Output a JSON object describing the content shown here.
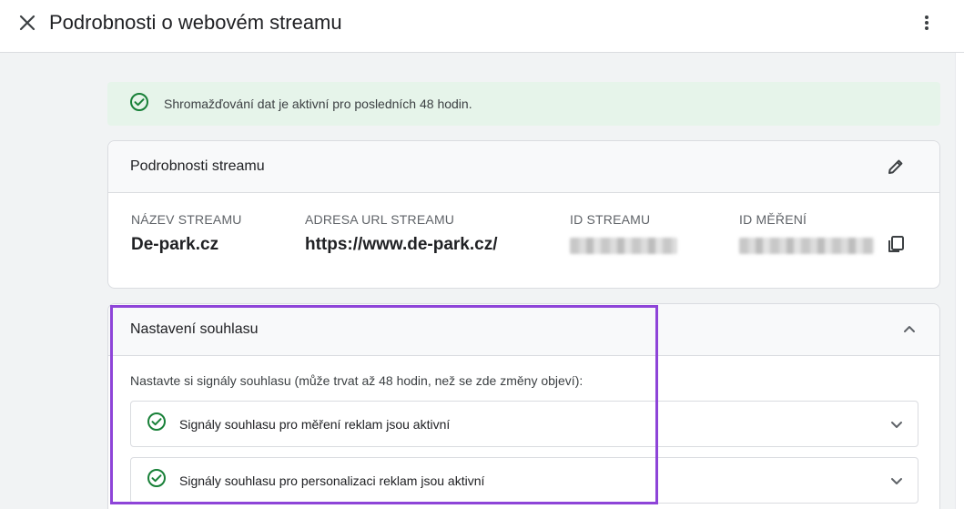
{
  "header": {
    "title": "Podrobnosti o webovém streamu",
    "close_icon": "close-icon",
    "more_icon": "more-vert-icon"
  },
  "banner": {
    "text": "Shromažďování dat je aktivní pro posledních 48 hodin.",
    "icon": "check-circle-icon",
    "color": "#188038"
  },
  "stream_details": {
    "title": "Podrobnosti streamu",
    "edit_icon": "pencil-icon",
    "fields": [
      {
        "label": "NÁZEV STREAMU",
        "value": "De-park.cz"
      },
      {
        "label": "ADRESA URL STREAMU",
        "value": "https://www.de-park.cz/"
      },
      {
        "label": "ID STREAMU",
        "value": ""
      },
      {
        "label": "ID MĚŘENÍ",
        "value": ""
      }
    ],
    "copy_icon": "copy-icon"
  },
  "consent": {
    "title": "Nastavení souhlasu",
    "description": "Nastavte si signály souhlasu (může trvat až 48 hodin, než se zde změny objeví):",
    "signals": [
      {
        "label": "Signály souhlasu pro měření reklam jsou aktivní"
      },
      {
        "label": "Signály souhlasu pro personalizaci reklam jsou aktivní"
      }
    ],
    "collapse_icon": "chevron-up-icon"
  },
  "colors": {
    "success": "#188038",
    "highlight": "#8e44d8",
    "banner_bg": "#e6f4ea"
  }
}
